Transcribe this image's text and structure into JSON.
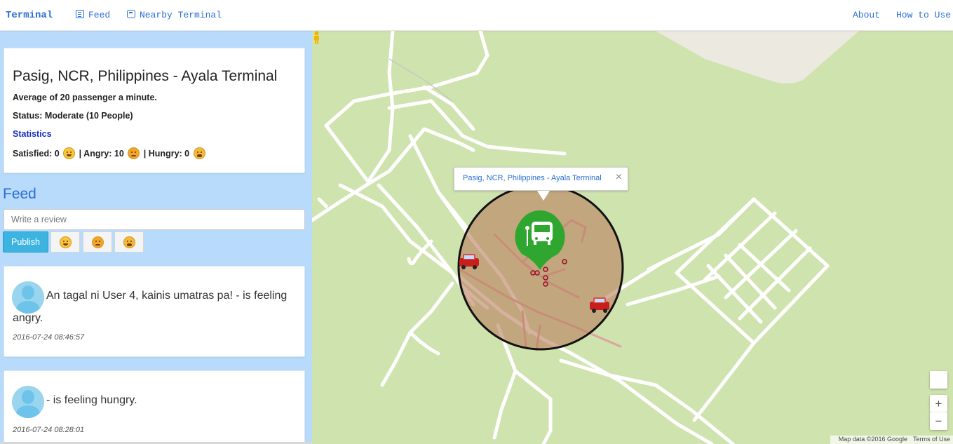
{
  "nav": {
    "brand": "Terminal",
    "feed": "Feed",
    "nearby": "Nearby Terminal",
    "about": "About",
    "how_to_use": "How to Use"
  },
  "terminal": {
    "title": "Pasig, NCR, Philippines - Ayala Terminal",
    "average": "Average of 20 passenger a minute.",
    "status": "Status: Moderate (10 People)",
    "statistics_link": "Statistics",
    "satisfied_label": "Satisfied: 0",
    "angry_label": "| Angry: 10",
    "hungry_label": "| Hungry: 0"
  },
  "feed": {
    "heading": "Feed",
    "input_placeholder": "Write a review",
    "publish_label": "Publish",
    "posts": [
      {
        "text": "An tagal ni User 4, kainis umatras pa! - is feeling angry.",
        "time": "2016-07-24 08:46:57"
      },
      {
        "text": "- is feeling hungry.",
        "time": "2016-07-24 08:28:01"
      }
    ]
  },
  "map": {
    "popup_title": "Pasig, NCR, Philippines - Ayala Terminal",
    "popup_close": "×",
    "zoom_in": "+",
    "zoom_out": "−",
    "footer_data": "Map data ©2016 Google",
    "footer_terms": "Terms of Use",
    "icons": [
      "bus-terminal-icon",
      "car-icon",
      "pegman-icon"
    ],
    "colors": {
      "land": "#cfe3ae",
      "road": "#ffffff",
      "radius": "#c4a07c",
      "marker": "#2fa62f"
    }
  }
}
